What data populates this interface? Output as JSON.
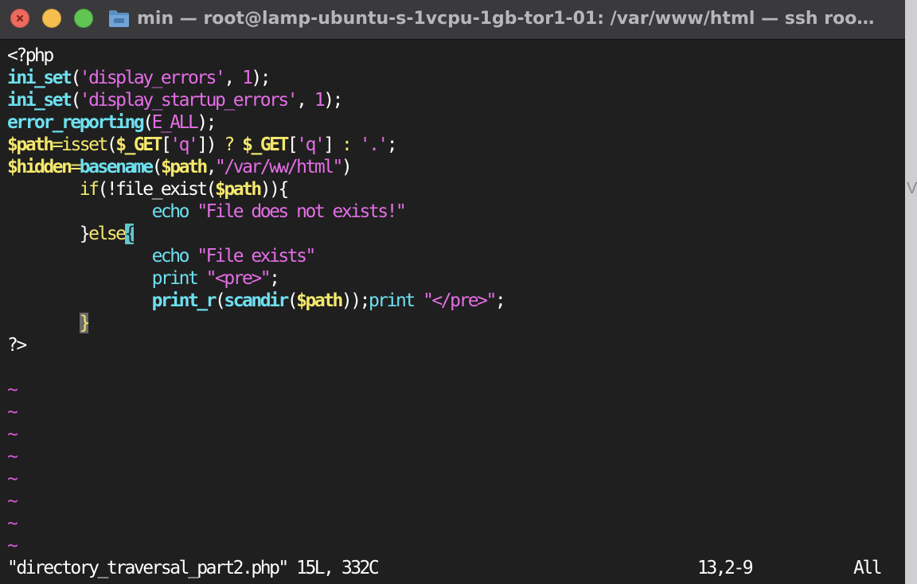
{
  "window": {
    "title": "min — root@lamp-ubuntu-s-1vcpu-1gb-tor1-01: /var/www/html — ssh roo…",
    "icons": [
      "close-button",
      "minimize-button",
      "zoom-button",
      "folder-icon"
    ]
  },
  "code": [
    [
      [
        "plain",
        "<?php"
      ]
    ],
    [
      [
        "fn",
        "ini_set"
      ],
      [
        "plain",
        "("
      ],
      [
        "str",
        "'display_errors'"
      ],
      [
        "plain",
        ", "
      ],
      [
        "num",
        "1"
      ],
      [
        "plain",
        ");"
      ]
    ],
    [
      [
        "fn",
        "ini_set"
      ],
      [
        "plain",
        "("
      ],
      [
        "str",
        "'display_startup_errors'"
      ],
      [
        "plain",
        ", "
      ],
      [
        "num",
        "1"
      ],
      [
        "plain",
        ");"
      ]
    ],
    [
      [
        "fn",
        "error_reporting"
      ],
      [
        "plain",
        "("
      ],
      [
        "str",
        "E_ALL"
      ],
      [
        "plain",
        ");"
      ]
    ],
    [
      [
        "var",
        "$path"
      ],
      [
        "kw",
        "="
      ],
      [
        "kw",
        "isset"
      ],
      [
        "plain",
        "("
      ],
      [
        "var",
        "$_GET"
      ],
      [
        "plain",
        "["
      ],
      [
        "str",
        "'q'"
      ],
      [
        "plain",
        "]) "
      ],
      [
        "kw",
        "?"
      ],
      [
        "plain",
        " "
      ],
      [
        "var",
        "$_GET"
      ],
      [
        "plain",
        "["
      ],
      [
        "str",
        "'q'"
      ],
      [
        "plain",
        "] "
      ],
      [
        "kw",
        ":"
      ],
      [
        "plain",
        " "
      ],
      [
        "str",
        "'.'"
      ],
      [
        "plain",
        ";"
      ]
    ],
    [
      [
        "var",
        "$hidden"
      ],
      [
        "kw",
        "="
      ],
      [
        "fn",
        "basename"
      ],
      [
        "plain",
        "("
      ],
      [
        "var",
        "$path"
      ],
      [
        "plain",
        ","
      ],
      [
        "str",
        "\"/var/ww/html\""
      ],
      [
        "plain",
        ")"
      ]
    ],
    [
      [
        "plain",
        "        "
      ],
      [
        "kw",
        "if"
      ],
      [
        "plain",
        "(!file_exist("
      ],
      [
        "var",
        "$path"
      ],
      [
        "plain",
        ")){"
      ]
    ],
    [
      [
        "plain",
        "                "
      ],
      [
        "id",
        "echo"
      ],
      [
        "plain",
        " "
      ],
      [
        "str",
        "\"File does not exists!\""
      ]
    ],
    [
      [
        "plain",
        "        }"
      ],
      [
        "kw",
        "else"
      ],
      [
        "cur",
        "{"
      ]
    ],
    [
      [
        "plain",
        "                "
      ],
      [
        "id",
        "echo"
      ],
      [
        "plain",
        " "
      ],
      [
        "str",
        "\"File exists\""
      ]
    ],
    [
      [
        "plain",
        "                "
      ],
      [
        "id",
        "print"
      ],
      [
        "plain",
        " "
      ],
      [
        "str",
        "\"<pre>\""
      ],
      [
        "plain",
        ";"
      ]
    ],
    [
      [
        "plain",
        "                "
      ],
      [
        "fn",
        "print_r"
      ],
      [
        "plain",
        "("
      ],
      [
        "fn",
        "scandir"
      ],
      [
        "plain",
        "("
      ],
      [
        "var",
        "$path"
      ],
      [
        "plain",
        "));"
      ],
      [
        "id",
        "print"
      ],
      [
        "plain",
        " "
      ],
      [
        "str",
        "\"</pre>\""
      ],
      [
        "plain",
        ";"
      ]
    ],
    [
      [
        "plain",
        "        "
      ],
      [
        "mbrace",
        "}"
      ]
    ],
    [
      [
        "plain",
        "?>"
      ]
    ],
    [],
    [
      [
        "tilde",
        "~"
      ]
    ],
    [
      [
        "tilde",
        "~"
      ]
    ],
    [
      [
        "tilde",
        "~"
      ]
    ],
    [
      [
        "tilde",
        "~"
      ]
    ],
    [
      [
        "tilde",
        "~"
      ]
    ],
    [
      [
        "tilde",
        "~"
      ]
    ],
    [
      [
        "tilde",
        "~"
      ]
    ],
    [
      [
        "tilde",
        "~"
      ]
    ]
  ],
  "status": {
    "file": "\"directory_traversal_part2.php\" 15L, 332C",
    "position": "13,2-9",
    "scroll": "All"
  },
  "edge_glyph": "V"
}
